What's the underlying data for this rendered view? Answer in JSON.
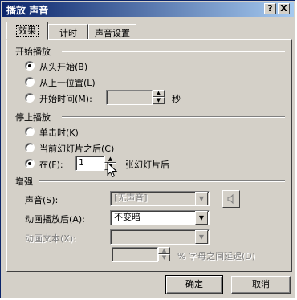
{
  "window": {
    "title": "播放 声音",
    "help_label": "?",
    "close_label": "X"
  },
  "tabs": [
    {
      "label": "效果",
      "active": true
    },
    {
      "label": "计时",
      "active": false
    },
    {
      "label": "声音设置",
      "active": false
    }
  ],
  "start_group": {
    "title": "开始播放",
    "options": [
      {
        "label": "从头开始(B)",
        "selected": true
      },
      {
        "label": "从上一位置(L)",
        "selected": false
      },
      {
        "label": "开始时间(M):",
        "selected": false
      }
    ],
    "time_value": "",
    "time_unit": "秒"
  },
  "stop_group": {
    "title": "停止播放",
    "options": [
      {
        "label": "单击时(K)",
        "selected": false
      },
      {
        "label": "当前幻灯片之后(C)",
        "selected": false
      },
      {
        "label": "在(F):",
        "selected": true
      }
    ],
    "after_value": "1",
    "after_suffix": "张幻灯片后"
  },
  "enhance_group": {
    "title": "增强",
    "sound_label": "声音(S):",
    "sound_value": "[无声音]",
    "after_anim_label": "动画播放后(A):",
    "after_anim_value": "不变暗",
    "anim_text_label": "动画文本(X):",
    "anim_text_value": "",
    "delay_value": "",
    "delay_suffix": "% 字母之间延迟(D)"
  },
  "footer": {
    "ok_label": "确定",
    "cancel_label": "取消"
  },
  "colors": {
    "title_start": "#0a246a",
    "title_end": "#a6caf0",
    "face": "#d4d0c8"
  }
}
